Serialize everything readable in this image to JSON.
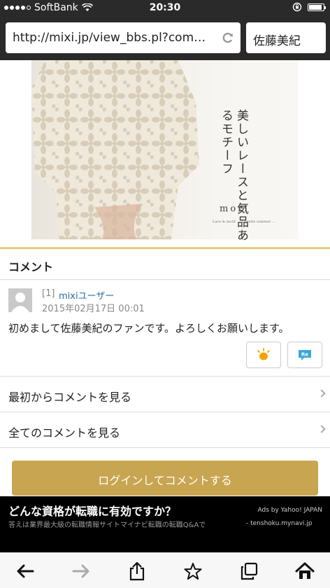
{
  "status_bar": {
    "carrier": "SoftBank",
    "time": "20:30",
    "battery_level": 0.9
  },
  "browser": {
    "url": "http://mixi.jp/view_bbs.pl?comm_id=...",
    "search_query": "佐藤美紀"
  },
  "hero": {
    "vertical_text": "美しいレースと気品あるモチーフ",
    "brand": "mori",
    "subtext": "Lace & motif ... a gentle summer ..."
  },
  "comments": {
    "header": "コメント",
    "items": [
      {
        "number": "[1]",
        "user": "mixiユーザー",
        "date": "2015年02月17日 00:01",
        "body": "初めまして佐藤美紀のファンです。よろしくお願いします。"
      }
    ],
    "like_icon": "sun-like-icon",
    "reply_icon": "re-reply-icon"
  },
  "links": {
    "view_from_start": "最初からコメントを見る",
    "view_all": "全てのコメントを見る"
  },
  "login_button": "ログインしてコメントする",
  "ad": {
    "label": "Ads by Yahoo! JAPAN",
    "title": "どんな資格が転職に有効ですか？",
    "description": "答えは業界最大級の転職情報サイトマイナビ転職の転職Q&Aで",
    "domain": "- tenshoku.mynavi.jp"
  },
  "toolbar": {
    "icons": [
      "back-arrow-icon",
      "forward-arrow-icon",
      "share-icon",
      "bookmark-star-icon",
      "tabs-icon",
      "home-icon"
    ]
  },
  "colors": {
    "accent": "#c8a550",
    "link": "#2b6ea7",
    "hero_line": "#e6c97a",
    "ad_bg": "#000000"
  }
}
